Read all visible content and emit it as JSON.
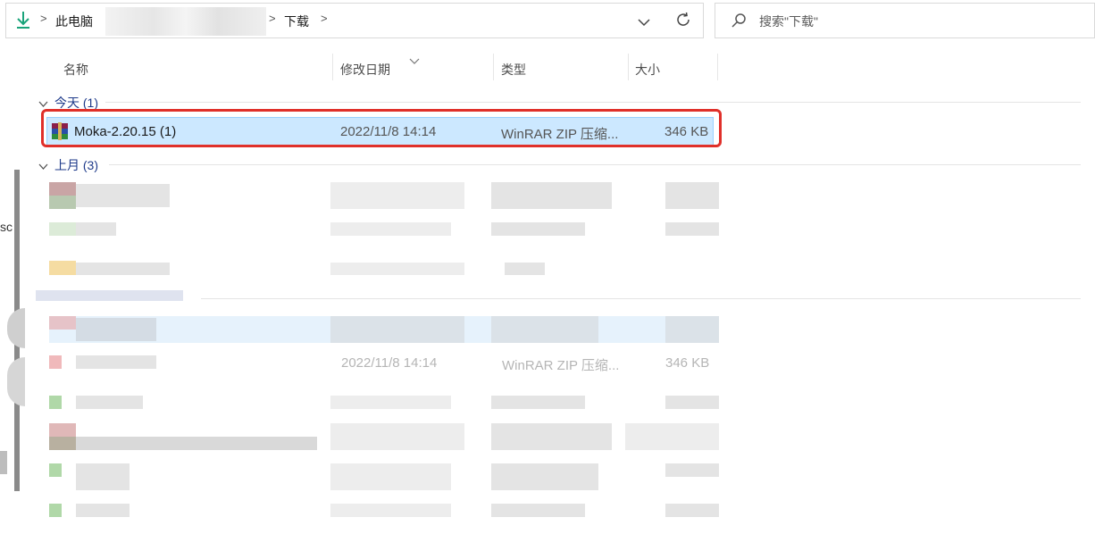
{
  "address_bar": {
    "crumbs": [
      "此电脑",
      "下载"
    ],
    "separators": [
      ">",
      ">",
      ">"
    ]
  },
  "search": {
    "placeholder": "搜索\"下载\""
  },
  "columns": {
    "name": "名称",
    "modified": "修改日期",
    "type": "类型",
    "size": "大小"
  },
  "groups": [
    {
      "label": "今天 (1)"
    },
    {
      "label": "上月 (3)"
    }
  ],
  "files": [
    {
      "name": "Moka-2.20.15 (1)",
      "modified": "2022/11/8 14:14",
      "type": "WinRAR ZIP 压缩...",
      "size": "346 KB"
    }
  ],
  "blurred_rows": [
    {
      "modified": "2022/11/8 14:14",
      "type": "WinRAR ZIP 压缩...",
      "size": "346 KB"
    }
  ],
  "left_edge_text": "sc",
  "colors": {
    "selection": "#cce8ff",
    "highlight_border": "#e0302a",
    "group_text": "#1e3a8a",
    "download_icon": "#1aa37a"
  },
  "icons": {
    "download": "download-arrow-icon",
    "chevron": "chevron-down-icon",
    "refresh": "refresh-icon",
    "search": "search-icon",
    "archive": "winrar-archive-icon"
  }
}
